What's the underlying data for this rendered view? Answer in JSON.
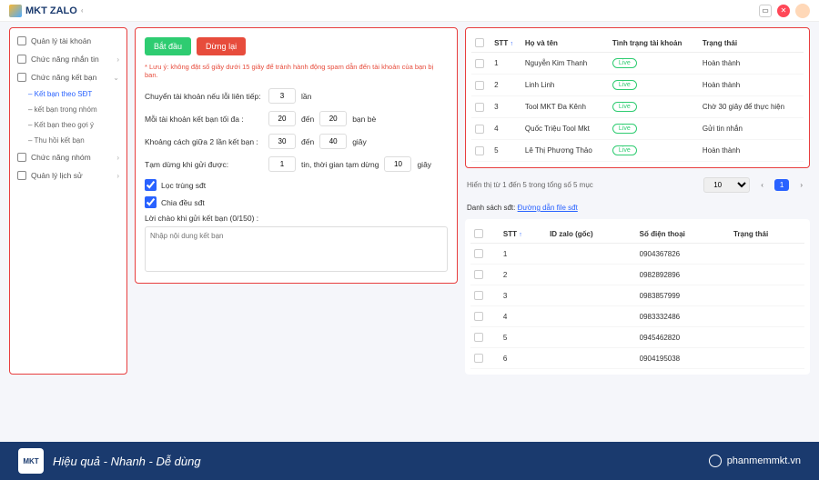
{
  "header": {
    "brand": "MKT ZALO"
  },
  "sidebar": {
    "items": [
      {
        "label": "Quản lý tài khoản"
      },
      {
        "label": "Chức năng nhắn tin"
      },
      {
        "label": "Chức năng kết bạn"
      },
      {
        "label": "Chức năng nhóm"
      },
      {
        "label": "Quản lý lịch sử"
      }
    ],
    "subs": [
      {
        "label": "Kết bạn theo SĐT"
      },
      {
        "label": "kết bạn trong nhóm"
      },
      {
        "label": "Kết bạn theo gợi ý"
      },
      {
        "label": "Thu hồi kết bạn"
      }
    ]
  },
  "form": {
    "start": "Bắt đầu",
    "stop": "Dừng lại",
    "warning": "* Lưu ý: không đặt số giây dưới 15 giây để tránh hành động spam dẫn đến tài khoản của bạn bị ban.",
    "r1_label": "Chuyển tài khoản nếu lỗi liên tiếp:",
    "r1_v": "3",
    "r1_unit": "lần",
    "r2_label": "Mỗi tài khoản kết bạn tối đa :",
    "r2_v1": "20",
    "r2_to": "đến",
    "r2_v2": "20",
    "r2_unit": "bạn bè",
    "r3_label": "Khoảng cách giữa 2 lần kết bạn :",
    "r3_v1": "30",
    "r3_to": "đến",
    "r3_v2": "40",
    "r3_unit": "giây",
    "r4_label": "Tạm dừng khi gửi được:",
    "r4_v1": "1",
    "r4_mid": "tin, thời gian tạm dừng",
    "r4_v2": "10",
    "r4_unit": "giây",
    "cb1": "Lọc trùng sđt",
    "cb2": "Chia đều sđt",
    "ta_label": "Lời chào khi gửi kết bạn (0/150) :",
    "ta_ph": "Nhập nội dung kết bạn"
  },
  "table1": {
    "cols": {
      "stt": "STT",
      "name": "Họ và tên",
      "status_acc": "Tình trạng tài khoản",
      "state": "Trạng thái"
    },
    "badge": "Live",
    "rows": [
      {
        "stt": "1",
        "name": "Nguyễn Kim Thanh",
        "state": "Hoàn thành"
      },
      {
        "stt": "2",
        "name": "Linh Linh",
        "state": "Hoàn thành"
      },
      {
        "stt": "3",
        "name": "Tool MKT Đa Kênh",
        "state": "Chờ 30 giây để thực hiện"
      },
      {
        "stt": "4",
        "name": "Quốc Triệu Tool Mkt",
        "state": "Gửi tin nhắn"
      },
      {
        "stt": "5",
        "name": "Lê Thị Phương Thảo",
        "state": "Hoàn thành"
      }
    ],
    "pag_info": "Hiển thị từ 1 đến 5 trong tổng số 5 mục",
    "pag_size": "10"
  },
  "filelink": {
    "label": "Danh sách sđt:",
    "link": "Đường dẫn file sđt"
  },
  "table2": {
    "cols": {
      "stt": "STT",
      "id": "ID zalo (gốc)",
      "phone": "Số điện thoại",
      "state": "Trạng thái"
    },
    "rows": [
      {
        "stt": "1",
        "phone": "0904367826"
      },
      {
        "stt": "2",
        "phone": "0982892896"
      },
      {
        "stt": "3",
        "phone": "0983857999"
      },
      {
        "stt": "4",
        "phone": "0983332486"
      },
      {
        "stt": "5",
        "phone": "0945462820"
      },
      {
        "stt": "6",
        "phone": "0904195038"
      }
    ]
  },
  "footer": {
    "logo": "MKT",
    "slogan": "Hiệu quả - Nhanh - Dễ dùng",
    "site": "phanmemmkt.vn"
  }
}
